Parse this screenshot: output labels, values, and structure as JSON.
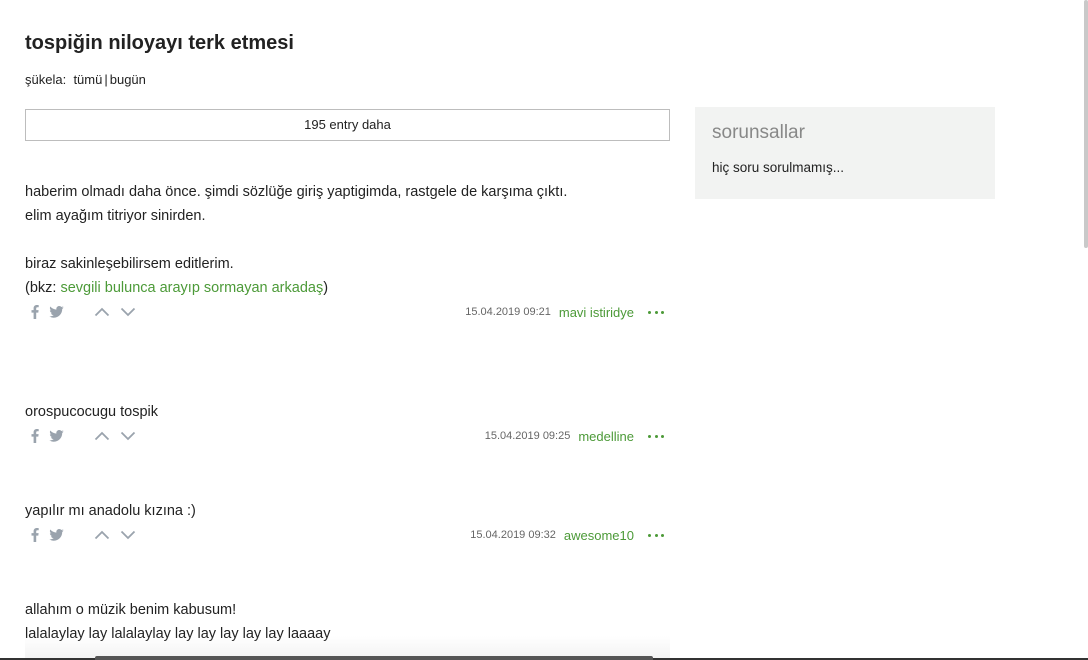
{
  "topic": {
    "title": "tospiğin niloyayı terk etmesi",
    "sukela_label": "şükela:",
    "sukela_all": "tümü",
    "sukela_sep": "|",
    "sukela_today": "bugün",
    "more_entries": "195 entry daha"
  },
  "entries": [
    {
      "content_lines": "haberim olmadı daha önce. şimdi sözlüğe giriş yaptigimda, rastgele de karşıma çıktı.\nelim ayağım titriyor sinirden.\n\nbiraz sakinleşebilirsem editlerim.\n",
      "bkz_prefix": "(bkz: ",
      "bkz_link": "sevgili bulunca arayıp sormayan arkadaş",
      "bkz_suffix": ")",
      "date": "15.04.2019 09:21",
      "author": "mavi istiridye"
    },
    {
      "content_lines": "orospucocugu tospik",
      "date": "15.04.2019 09:25",
      "author": "medelline"
    },
    {
      "content_lines": "yapılır mı anadolu kızına :)",
      "date": "15.04.2019 09:32",
      "author": "awesome10"
    },
    {
      "content_lines": "allahım o müzik benim kabusum!\nlalalaylay lay lalalaylay lay lay lay lay lay laaaay"
    }
  ],
  "aside": {
    "title": "sorunsallar",
    "text": "hiç soru sorulmamış..."
  },
  "icons": {
    "facebook": "facebook-icon",
    "twitter": "twitter-icon",
    "upvote": "chevron-up-icon",
    "downvote": "chevron-down-icon",
    "more": "more-dots-icon"
  },
  "colors": {
    "accent": "#4c9a38",
    "icon_gray": "#9aa3ad",
    "aside_bg": "#f2f3f2"
  }
}
